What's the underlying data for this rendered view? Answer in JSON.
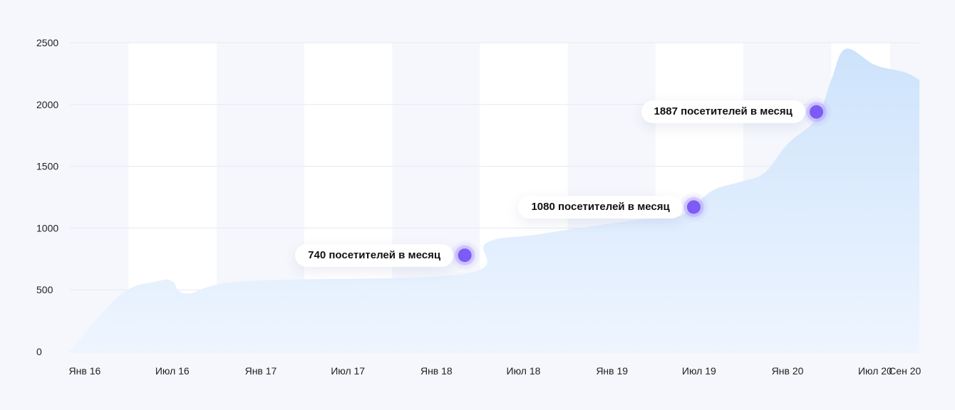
{
  "chart_data": {
    "type": "area",
    "x": [
      "2015-12-01",
      "2016-03-15",
      "2016-06-01",
      "2016-07-01",
      "2016-08-01",
      "2016-12-01",
      "2018-03-01",
      "2018-04-15",
      "2018-08-01",
      "2019-03-01",
      "2019-05-15",
      "2019-06-20",
      "2019-08-01",
      "2019-10-01",
      "2019-11-15",
      "2020-01-01",
      "2020-03-01",
      "2020-04-01",
      "2020-05-01",
      "2020-07-01",
      "2020-09-01",
      "2020-10-01"
    ],
    "values": [
      0,
      460,
      570,
      570,
      470,
      570,
      630,
      880,
      950,
      1070,
      1090,
      1180,
      1310,
      1380,
      1450,
      1680,
      1887,
      2200,
      2450,
      2320,
      2260,
      2200
    ],
    "xticks": [
      {
        "label": "Янв 16",
        "date": "2016-01-01"
      },
      {
        "label": "Июл 16",
        "date": "2016-07-01"
      },
      {
        "label": "Янв 17",
        "date": "2017-01-01"
      },
      {
        "label": "Июл 17",
        "date": "2017-07-01"
      },
      {
        "label": "Янв 18",
        "date": "2018-01-01"
      },
      {
        "label": "Июл 18",
        "date": "2018-07-01"
      },
      {
        "label": "Янв 19",
        "date": "2019-01-01"
      },
      {
        "label": "Июл 19",
        "date": "2019-07-01"
      },
      {
        "label": "Янв 20",
        "date": "2020-01-01"
      },
      {
        "label": "Июл 20",
        "date": "2020-07-01"
      },
      {
        "label": "Сен 20",
        "date": "2020-09-01"
      }
    ],
    "yticks": [
      0,
      500,
      1000,
      1500,
      2000,
      2500
    ],
    "ylim": [
      0,
      2500
    ],
    "xlim": [
      "2015-12-01",
      "2020-10-01"
    ],
    "grid": true,
    "annotations": [
      {
        "date": "2018-03-01",
        "value": 780,
        "label": "740 посетителей в месяц"
      },
      {
        "date": "2019-06-20",
        "value": 1170,
        "label": "1080 посетителей в месяц"
      },
      {
        "date": "2020-03-01",
        "value": 1940,
        "label": "1887 посетителей в месяц"
      }
    ],
    "title": "",
    "xlabel": "",
    "ylabel": "",
    "colors": {
      "area_top": "#cde3fb",
      "area_bottom": "#eef5ff",
      "marker": "#7c5cf5",
      "marker_halo": "#a992fb",
      "gridline": "#e6e9f1",
      "band": "#ffffff",
      "background": "#f5f7fc"
    }
  }
}
